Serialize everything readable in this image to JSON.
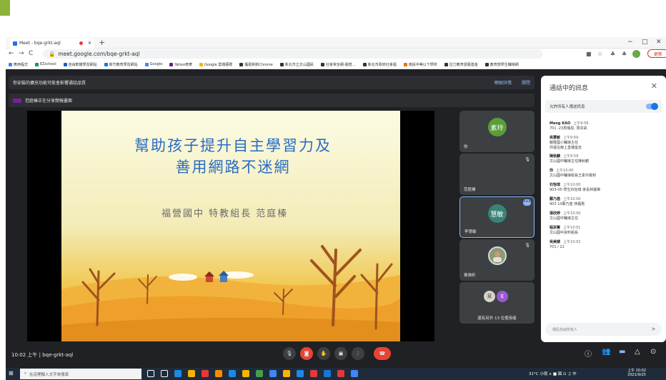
{
  "browser": {
    "tab_title": "Meet - bqe-grkt-aql",
    "new_tab": "+",
    "url": "meet.google.com/bqe-grkt-aql",
    "update_label": "更新",
    "window_controls": [
      "−",
      "□",
      "✕"
    ],
    "bookmarks": [
      "應用程式",
      "EZschool",
      "自由軟體學習網站",
      "新竹教育學習網站",
      "Google",
      "Yahoo奇摩",
      "Google 雲端硬碟",
      "獲取對新Chrome",
      "新北市立文山國民",
      "社會常全網-開普…",
      "新北市政府社會福",
      "南投中等以下學校",
      "拉力教育發展基金",
      "教育部學生輔導網"
    ]
  },
  "meet": {
    "notice_text": "你安裝的擴充功能可能會影響通話品質",
    "notice_links": [
      "瞭解詳情",
      "關閉"
    ],
    "share_text": "范庭榛正在分享簡報畫面",
    "meeting_info": "10:02 上午 | bqe-grkt-aql"
  },
  "slide": {
    "title_line1": "幫助孩子提升自主學習力及",
    "title_line2": "善用網路不迷網",
    "subtitle": "福營國中 特教組長 范庭榛"
  },
  "tiles": [
    {
      "avatar": "素玲",
      "name": "你",
      "color": "#5a9e3b"
    },
    {
      "avatar": "",
      "name": "范庭榛",
      "color": ""
    },
    {
      "avatar": "慧敏",
      "name": "李慧敏",
      "color": "#3a8277"
    },
    {
      "avatar": "",
      "name": "黃偉昕",
      "color": ""
    },
    {
      "avatar": "",
      "name": "還有另外 13 位使用者",
      "color": ""
    }
  ],
  "others_avatars": [
    "莱",
    "E"
  ],
  "chat": {
    "title": "通話中的訊息",
    "close": "✕",
    "toggle_label": "允許所有人傳送訊息",
    "messages": [
      {
        "who": "Meng KAO",
        "time": "上午9:59",
        "text": "701 -23周瑞恩, 周青凱"
      },
      {
        "who": "吳慧敏",
        "time": "上午9:59",
        "text": "龍隆國小輔導主任\n你還在線上直播室去"
      },
      {
        "who": "陳秋麟",
        "time": "上午9:59",
        "text": "文山國中輔導主任陳秋麟"
      },
      {
        "who": "你",
        "time": "上午10:00",
        "text": "文山國中輔導組長王素玲敬到"
      },
      {
        "who": "石怡琪",
        "time": "上午10:00",
        "text": "903-05-學生石怡琪 家長林麗琳"
      },
      {
        "who": "鄭乃菡",
        "time": "上午10:00",
        "text": "903 10鄭乃菡 林麗惠"
      },
      {
        "who": "張欣婷",
        "time": "上午10:00",
        "text": "文山國中輔導主任"
      },
      {
        "who": "程宗賢",
        "time": "上午10:01",
        "text": "文山國中資料組長"
      },
      {
        "who": "吳美婕",
        "time": "上午10:02",
        "text": "701 / 22"
      }
    ],
    "input_placeholder": "傳訊息給所有人"
  },
  "taskbar": {
    "search_placeholder": "在這裡輸入文字來搜尋",
    "tray": "31°C 小雨 ∧ ■ 図 ⊡ ♫ 中",
    "time": "上午 10:02",
    "date": "2021/9/25"
  }
}
